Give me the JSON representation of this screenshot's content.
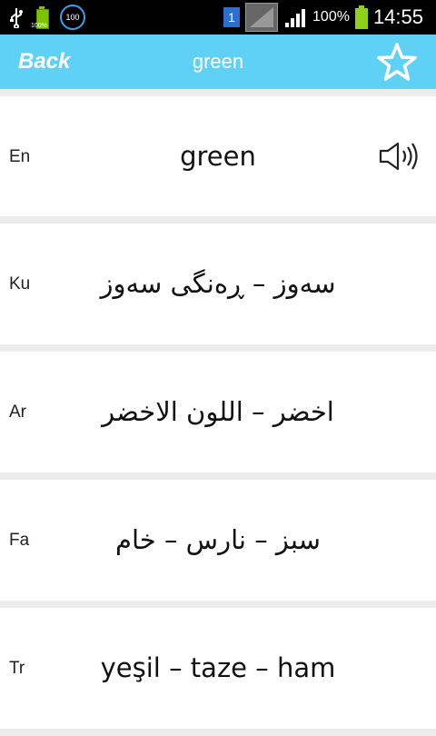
{
  "status_bar": {
    "battery_small_label": "100%",
    "circle_label": "100",
    "sim_label": "1",
    "battery_percent": "100%",
    "time": "14:55"
  },
  "app_bar": {
    "back_label": "Back",
    "title": "green"
  },
  "entries": [
    {
      "lang": "En",
      "text": "green"
    },
    {
      "lang": "Ku",
      "text": "سەوز – ڕەنگی سەوز"
    },
    {
      "lang": "Ar",
      "text": "اخضر – اللون الاخضر"
    },
    {
      "lang": "Fa",
      "text": "سبز – نارس – خام"
    },
    {
      "lang": "Tr",
      "text": "yeşil – taze – ham"
    }
  ],
  "colors": {
    "app_bar": "#5fd1f4",
    "battery": "#8fd11a"
  }
}
